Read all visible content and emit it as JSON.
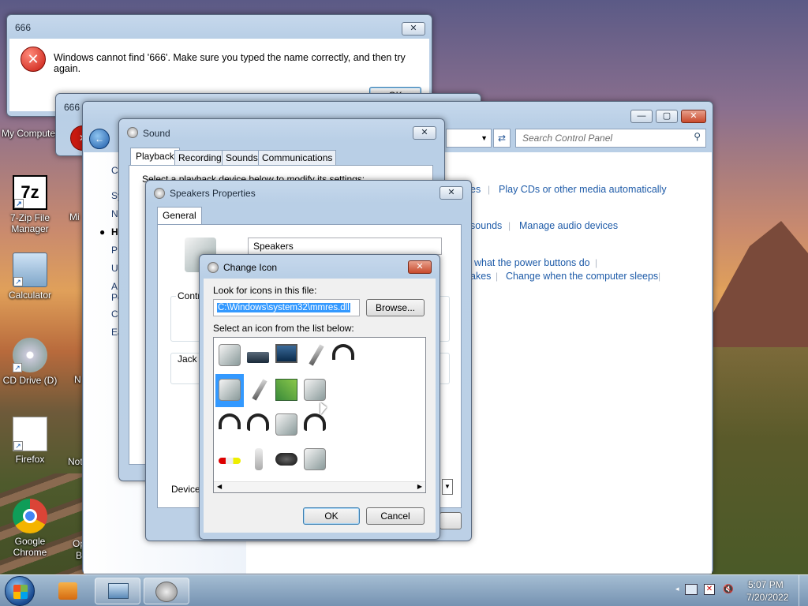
{
  "desktop": {
    "icons": [
      {
        "label": "My Computer"
      },
      {
        "label": "7-Zip File Manager"
      },
      {
        "label": "Calculator"
      },
      {
        "label": "CD Drive (D)"
      },
      {
        "label": "Firefox"
      },
      {
        "label": "Google Chrome"
      }
    ],
    "partial_labels": [
      "Mi",
      "N",
      "Not",
      "Op",
      "B"
    ]
  },
  "error_dialog": {
    "title": "666",
    "message": "Windows cannot find '666'. Make sure you typed the name correctly, and then try again.",
    "ok_label": "OK",
    "close_label": "✕"
  },
  "error_dialog_2": {
    "title": "666"
  },
  "control_panel": {
    "search_placeholder": "Search Control Panel",
    "sidebar_letters": [
      "C",
      "Sy",
      "N",
      "H",
      "P",
      "U",
      "A",
      "Pe",
      "C",
      "Ea"
    ],
    "links": [
      "es",
      "Play CDs or other media automatically",
      "sounds",
      "Manage audio devices",
      "what the power buttons do",
      "akes",
      "Change when the computer sleeps"
    ]
  },
  "sound_dialog": {
    "title": "Sound",
    "tabs": [
      "Playback",
      "Recording",
      "Sounds",
      "Communications"
    ],
    "partial_text": "Select a playback device below to modify its settings:"
  },
  "speakers_props": {
    "title": "Speakers Properties",
    "tab_general": "General",
    "name_value": "Speakers",
    "controller_label": "Contr",
    "jack_label": "Jack In",
    "device_label": "Device"
  },
  "change_icon": {
    "title": "Change Icon",
    "look_label": "Look for icons in this file:",
    "file_value": "C:\\Windows\\system32\\mmres.dll",
    "browse_label": "Browse...",
    "select_label": "Select an icon from the list below:",
    "ok_label": "OK",
    "cancel_label": "Cancel",
    "icons": [
      "speaker-icon",
      "dvd-drive-icon",
      "monitor-icon",
      "microphone-icon",
      "headphones-icon",
      "speaker-icon",
      "microphone-icon",
      "circuit-board-icon",
      "speaker-icon",
      "headphones-icon",
      "headset-icon",
      "speaker-icon",
      "headset-icon",
      "rca-cable-icon",
      "phone-handset-icon",
      "webcam-icon",
      "speaker-icon"
    ],
    "selected_index": 5
  },
  "taskbar": {
    "time": "5:07 PM",
    "date": "7/20/2022"
  }
}
